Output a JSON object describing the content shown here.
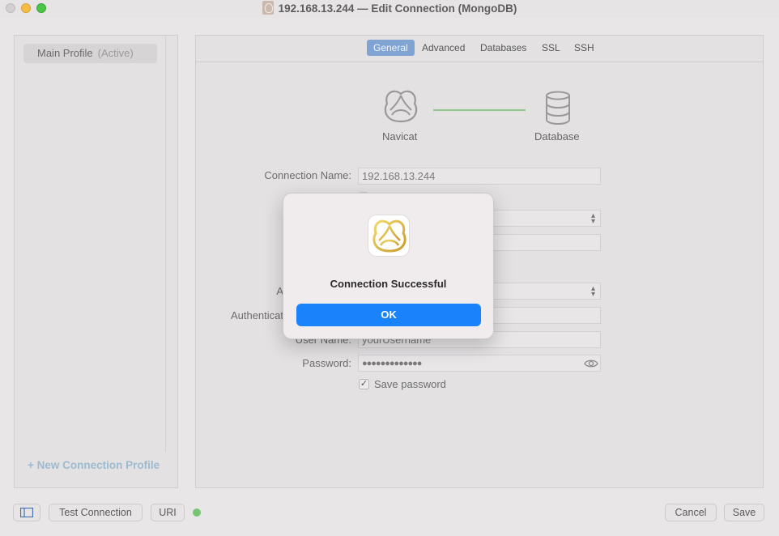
{
  "window": {
    "title": "192.168.13.244 — Edit Connection (MongoDB)"
  },
  "sidebar": {
    "profile_name": "Main Profile",
    "profile_status": "(Active)",
    "new_profile_label": "+ New Connection Profile"
  },
  "tabs": [
    {
      "label": "General",
      "selected": true
    },
    {
      "label": "Advanced",
      "selected": false
    },
    {
      "label": "Databases",
      "selected": false
    },
    {
      "label": "SSL",
      "selected": false
    },
    {
      "label": "SSH",
      "selected": false
    }
  ],
  "diagram": {
    "left_label": "Navicat",
    "right_label": "Database"
  },
  "form": {
    "connection_name_label": "Connection Name:",
    "connection_name_value": "192.168.13.244",
    "authentication_label_partial": "Authenticat",
    "auth_row_label_partial": "A",
    "user_name_label": "User Name:",
    "user_name_value": "yourUsername",
    "password_label": "Password:",
    "password_value": "●●●●●●●●●●●●●",
    "save_password_label": "Save password",
    "save_password_checked": "✓"
  },
  "bottom_bar": {
    "test_connection_label": "Test Connection",
    "uri_label": "URI",
    "cancel_label": "Cancel",
    "save_label": "Save"
  },
  "dialog": {
    "title": "Connection Successful",
    "ok_label": "OK"
  },
  "colors": {
    "accent": "#1a83fb",
    "tab_selected": "#7fa3d2",
    "status_ok": "#78c473"
  }
}
